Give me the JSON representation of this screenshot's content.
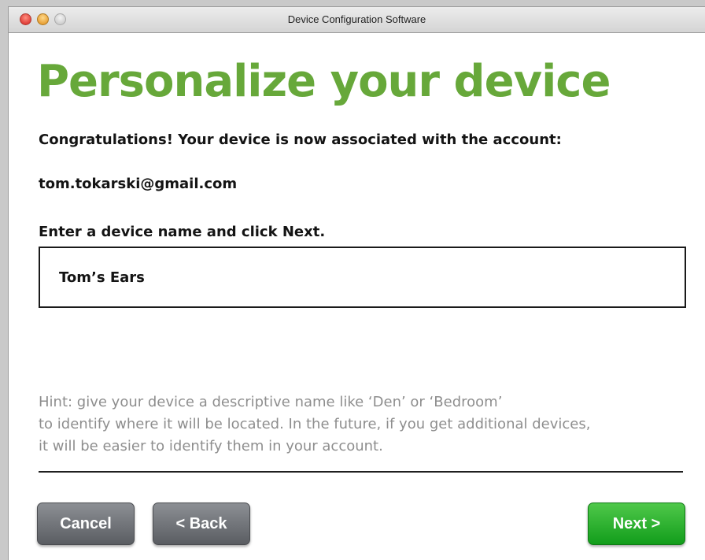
{
  "window": {
    "title": "Device Configuration Software"
  },
  "page": {
    "title": "Personalize your device",
    "congrats": "Congratulations! Your device is now associated with the account:",
    "account_email": "tom.tokarski@gmail.com",
    "prompt": "Enter a device name and click Next."
  },
  "device_name_input": {
    "value": "Tom’s Ears"
  },
  "hint": {
    "lines": [
      "Hint: give your device a descriptive name like ‘Den’ or ‘Bedroom’",
      "to identify where it will be located.  In the future, if you get additional devices,",
      "it will be easier to identify them in your account."
    ]
  },
  "buttons": {
    "cancel": "Cancel",
    "back": "< Back",
    "next": "Next >"
  },
  "colors": {
    "title_green": "#67a83a",
    "next_green": "#1aa623",
    "button_gray": "#6b6e73"
  }
}
